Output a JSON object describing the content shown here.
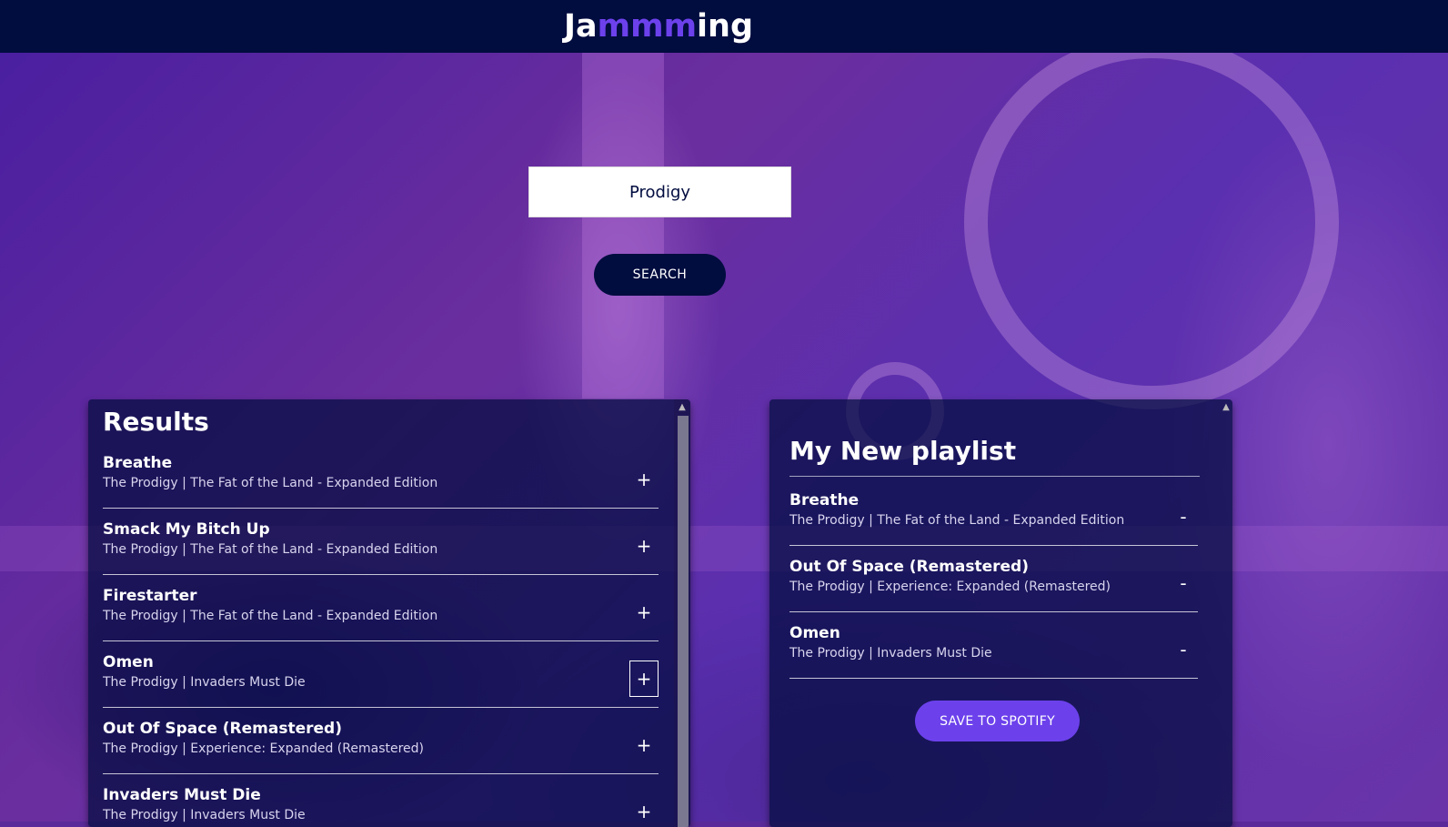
{
  "app": {
    "logo_prefix": "Ja",
    "logo_accent": "mmm",
    "logo_suffix": "ing"
  },
  "search": {
    "value": "Prodigy",
    "button_label": "SEARCH"
  },
  "results": {
    "title": "Results",
    "add_symbol": "+",
    "tracks": [
      {
        "name": "Breathe",
        "info": "The Prodigy | The Fat of the Land - Expanded Edition"
      },
      {
        "name": "Smack My Bitch Up",
        "info": "The Prodigy | The Fat of the Land - Expanded Edition"
      },
      {
        "name": "Firestarter",
        "info": "The Prodigy | The Fat of the Land - Expanded Edition"
      },
      {
        "name": "Omen",
        "info": "The Prodigy | Invaders Must Die"
      },
      {
        "name": "Out Of Space (Remastered)",
        "info": "The Prodigy | Experience: Expanded (Remastered)"
      },
      {
        "name": "Invaders Must Die",
        "info": "The Prodigy | Invaders Must Die"
      }
    ]
  },
  "playlist": {
    "title": "My New playlist",
    "remove_symbol": "-",
    "save_label": "SAVE TO SPOTIFY",
    "tracks": [
      {
        "name": "Breathe",
        "info": "The Prodigy | The Fat of the Land - Expanded Edition"
      },
      {
        "name": "Out Of Space (Remastered)",
        "info": "The Prodigy | Experience: Expanded (Remastered)"
      },
      {
        "name": "Omen",
        "info": "The Prodigy | Invaders Must Die"
      }
    ]
  },
  "colors": {
    "header": "#010c3f",
    "accent": "#6c41ec",
    "panel": "#010c3f"
  }
}
